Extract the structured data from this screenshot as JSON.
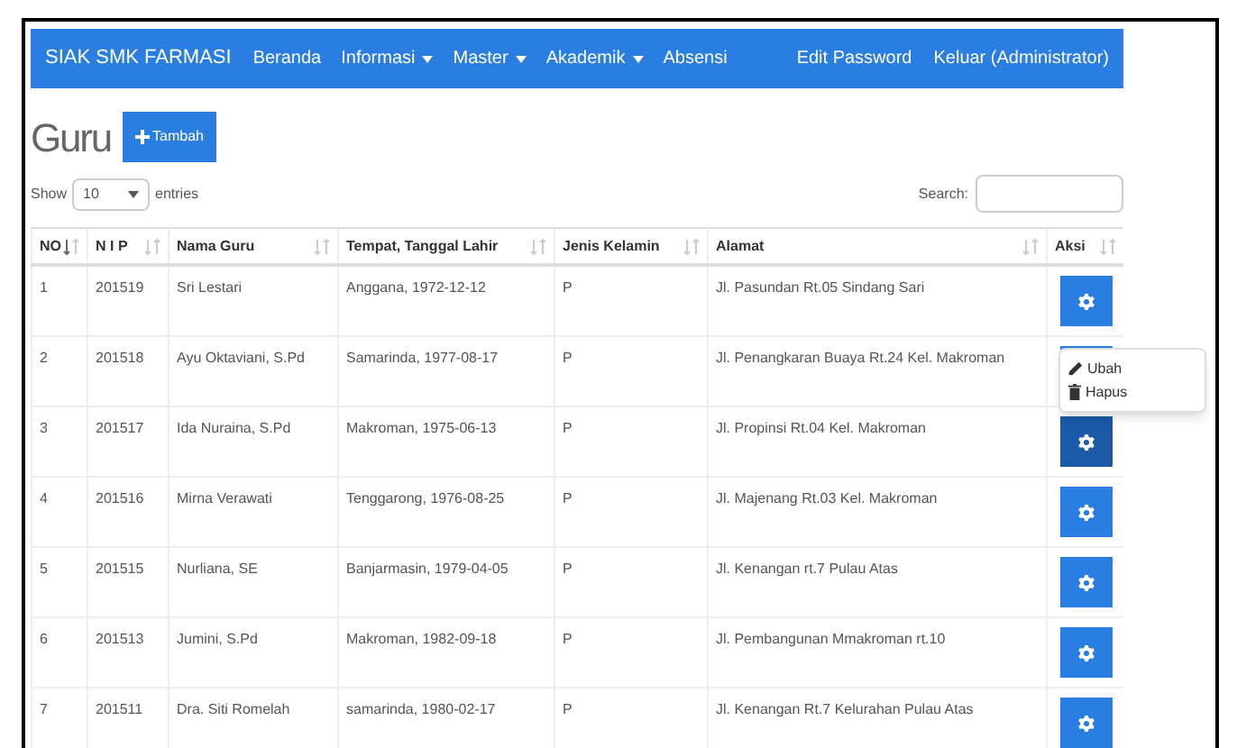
{
  "navbar": {
    "brand": "SIAK SMK FARMASI",
    "items": [
      {
        "label": "Beranda",
        "dropdown": false
      },
      {
        "label": "Informasi",
        "dropdown": true
      },
      {
        "label": "Master",
        "dropdown": true
      },
      {
        "label": "Akademik",
        "dropdown": true
      },
      {
        "label": "Absensi",
        "dropdown": false
      }
    ],
    "right_items": [
      "Edit Password",
      "Keluar (Administrator)"
    ]
  },
  "page_title": "Guru",
  "add_button": "Tambah",
  "length_control": {
    "before": "Show",
    "value": "10",
    "after": "entries"
  },
  "search": {
    "label": "Search:"
  },
  "table": {
    "columns": [
      {
        "label": "NO",
        "sorted": true
      },
      {
        "label": "N I P",
        "sorted": false
      },
      {
        "label": "Nama Guru",
        "sorted": false
      },
      {
        "label": "Tempat, Tanggal Lahir",
        "sorted": false
      },
      {
        "label": "Jenis Kelamin",
        "sorted": false
      },
      {
        "label": "Alamat",
        "sorted": false
      },
      {
        "label": "Aksi",
        "sorted": false
      }
    ],
    "rows": [
      {
        "cells": [
          "1",
          "201519",
          "Sri Lestari",
          "Anggana, 1972-12-12",
          "P",
          "Jl. Pasundan Rt.05 Sindang Sari"
        ],
        "menu_open": false
      },
      {
        "cells": [
          "2",
          "201518",
          "Ayu Oktaviani, S.Pd",
          "Samarinda, 1977-08-17",
          "P",
          "Jl. Penangkaran Buaya Rt.24 Kel. Makroman"
        ],
        "menu_open": false
      },
      {
        "cells": [
          "3",
          "201517",
          "Ida Nuraina, S.Pd",
          "Makroman, 1975-06-13",
          "P",
          "Jl. Propinsi Rt.04 Kel. Makroman"
        ],
        "menu_open": true
      },
      {
        "cells": [
          "4",
          "201516",
          "Mirna Verawati",
          "Tenggarong, 1976-08-25",
          "P",
          "Jl. Majenang Rt.03 Kel. Makroman"
        ],
        "menu_open": false
      },
      {
        "cells": [
          "5",
          "201515",
          "Nurliana, SE",
          "Banjarmasin, 1979-04-05",
          "P",
          "Jl. Kenangan rt.7 Pulau Atas"
        ],
        "menu_open": false
      },
      {
        "cells": [
          "6",
          "201513",
          "Jumini, S.Pd",
          "Makroman, 1982-09-18",
          "P",
          "Jl. Pembangunan Mmakroman rt.10"
        ],
        "menu_open": false
      },
      {
        "cells": [
          "7",
          "201511",
          "Dra. Siti Romelah",
          "samarinda, 1980-02-17",
          "P",
          "Jl. Kenangan Rt.7 Kelurahan Pulau Atas"
        ],
        "menu_open": false
      }
    ]
  },
  "action_menu": [
    {
      "label": "Ubah",
      "kind": "edit"
    },
    {
      "label": "Hapus",
      "kind": "delete"
    }
  ]
}
